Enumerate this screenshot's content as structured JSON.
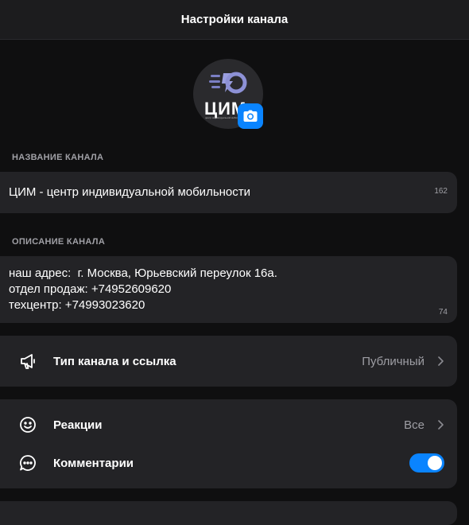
{
  "header": {
    "title": "Настройки канала"
  },
  "avatar": {
    "logo_text": "ЦИМ",
    "logo_subtext": "центр индивидуальной мобильности"
  },
  "name_section": {
    "label": "НАЗВАНИЕ КАНАЛА",
    "value": "ЦИМ - центр индивидуальной мобильности",
    "counter": "162"
  },
  "description_section": {
    "label": "ОПИСАНИЕ КАНАЛА",
    "lines": [
      "наш адрес:  г. Москва, Юрьевский переулок 16а.",
      "отдел продаж: +74952609620",
      "техцентр: +74993023620"
    ],
    "counter": "74"
  },
  "channel_type": {
    "label": "Тип канала и ссылка",
    "value": "Публичный",
    "icon": "megaphone-icon"
  },
  "reactions": {
    "label": "Реакции",
    "value": "Все",
    "icon": "smile-icon"
  },
  "comments": {
    "label": "Комментарии",
    "enabled": true,
    "icon": "comment-icon"
  },
  "colors": {
    "accent": "#0a84ff",
    "background": "#0f0f10",
    "card": "#232326"
  }
}
